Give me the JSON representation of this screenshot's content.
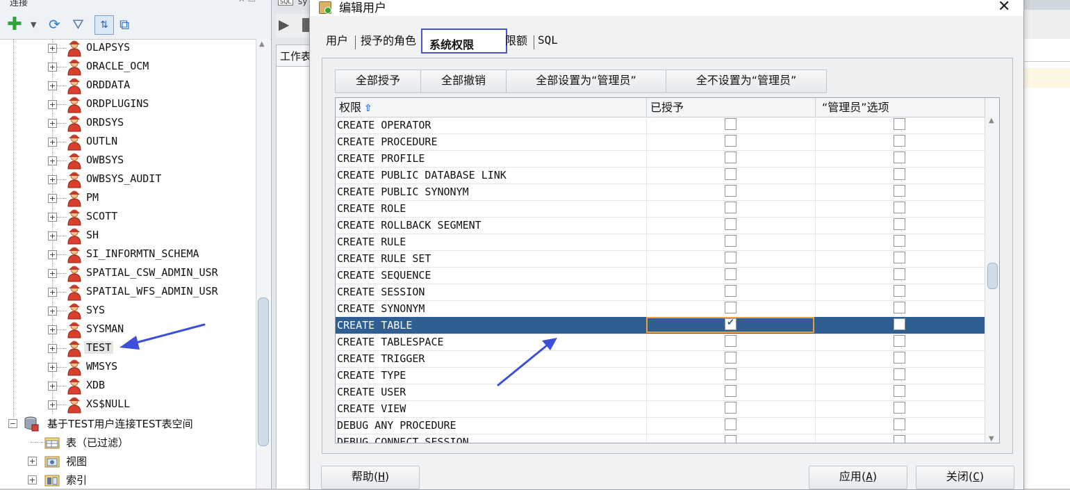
{
  "left_panel": {
    "title": "连接",
    "tree_users": [
      "OLAPSYS",
      "ORACLE_OCM",
      "ORDDATA",
      "ORDPLUGINS",
      "ORDSYS",
      "OUTLN",
      "OWBSYS",
      "OWBSYS_AUDIT",
      "PM",
      "SCOTT",
      "SH",
      "SI_INFORMTN_SCHEMA",
      "SPATIAL_CSW_ADMIN_USR",
      "SPATIAL_WFS_ADMIN_USR",
      "SYS",
      "SYSMAN",
      "TEST",
      "WMSYS",
      "XDB",
      "XS$NULL"
    ],
    "highlighted_user": "TEST",
    "connection_node": "基于TEST用户连接TEST表空间",
    "connection_children": [
      "表（已过滤）",
      "视图",
      "索引"
    ]
  },
  "middle": {
    "sql_tab_label": "sy",
    "worksheet_tab_label": "工作表"
  },
  "dialog": {
    "title": "编辑用户",
    "close_symbol": "✕",
    "tabs": [
      "用户",
      "授予的角色",
      "系统权限",
      "限额",
      "SQL"
    ],
    "active_tab": "系统权限",
    "grant_buttons": [
      "全部授予",
      "全部撤销",
      "全部设置为“管理员”",
      "全不设置为“管理员”"
    ],
    "table": {
      "headers": [
        "权限",
        "已授予",
        "“管理员”选项"
      ],
      "rows": [
        {
          "privilege": "CREATE OPERATOR",
          "granted": false,
          "admin": false
        },
        {
          "privilege": "CREATE PROCEDURE",
          "granted": false,
          "admin": false
        },
        {
          "privilege": "CREATE PROFILE",
          "granted": false,
          "admin": false
        },
        {
          "privilege": "CREATE PUBLIC DATABASE LINK",
          "granted": false,
          "admin": false
        },
        {
          "privilege": "CREATE PUBLIC SYNONYM",
          "granted": false,
          "admin": false
        },
        {
          "privilege": "CREATE ROLE",
          "granted": false,
          "admin": false
        },
        {
          "privilege": "CREATE ROLLBACK SEGMENT",
          "granted": false,
          "admin": false
        },
        {
          "privilege": "CREATE RULE",
          "granted": false,
          "admin": false
        },
        {
          "privilege": "CREATE RULE SET",
          "granted": false,
          "admin": false
        },
        {
          "privilege": "CREATE SEQUENCE",
          "granted": false,
          "admin": false
        },
        {
          "privilege": "CREATE SESSION",
          "granted": false,
          "admin": false
        },
        {
          "privilege": "CREATE SYNONYM",
          "granted": false,
          "admin": false
        },
        {
          "privilege": "CREATE TABLE",
          "granted": true,
          "admin": false,
          "selected": true
        },
        {
          "privilege": "CREATE TABLESPACE",
          "granted": false,
          "admin": false
        },
        {
          "privilege": "CREATE TRIGGER",
          "granted": false,
          "admin": false
        },
        {
          "privilege": "CREATE TYPE",
          "granted": false,
          "admin": false
        },
        {
          "privilege": "CREATE USER",
          "granted": false,
          "admin": false
        },
        {
          "privilege": "CREATE VIEW",
          "granted": false,
          "admin": false
        },
        {
          "privilege": "DEBUG ANY PROCEDURE",
          "granted": false,
          "admin": false
        },
        {
          "privilege": "DEBUG CONNECT SESSION",
          "granted": false,
          "admin": false
        }
      ]
    },
    "footer": {
      "help_label": "帮助",
      "help_key": "H",
      "apply_label": "应用",
      "apply_key": "A",
      "close_label": "关闭",
      "close_key": "C"
    }
  },
  "colors": {
    "selection_blue": "#2f5f92",
    "tab_highlight": "#4a4fd6",
    "annotation_arrow": "#3b4fd8",
    "focus_border": "#e8a33a"
  }
}
